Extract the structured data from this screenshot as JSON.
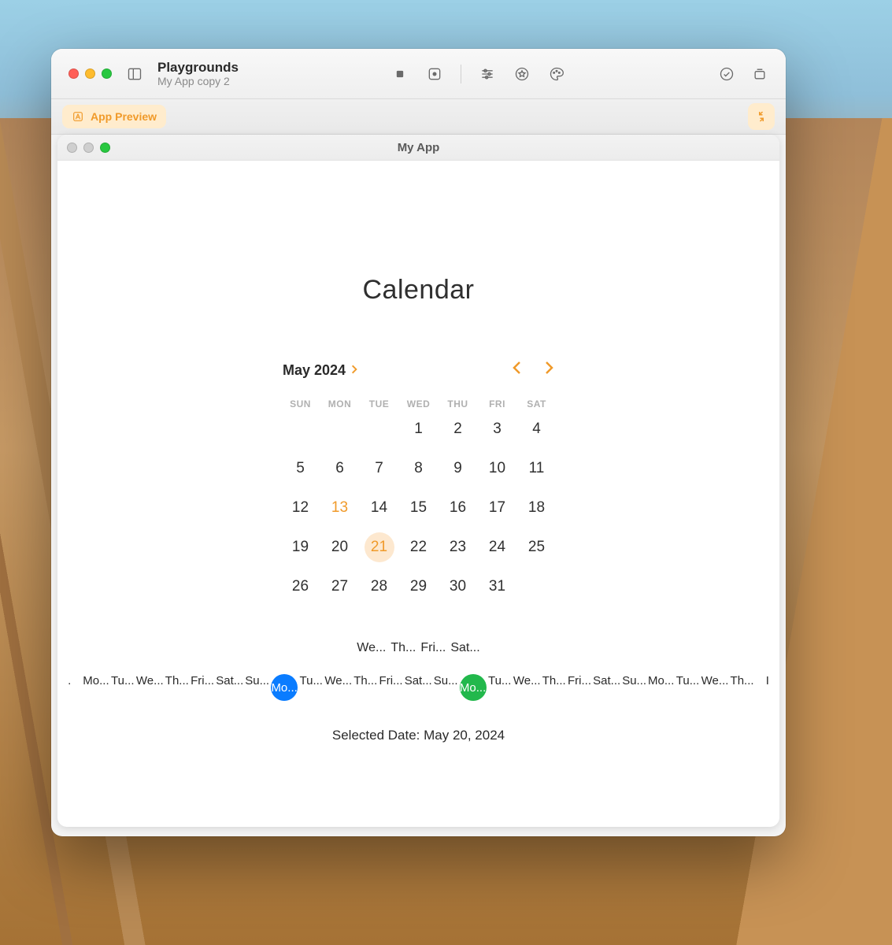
{
  "window": {
    "app_title": "Playgrounds",
    "doc_title": "My App copy 2"
  },
  "subbar": {
    "badge": "App Preview"
  },
  "inner": {
    "title": "My App"
  },
  "calendar": {
    "heading": "Calendar",
    "month": "May 2024",
    "dow": [
      "SUN",
      "MON",
      "TUE",
      "WED",
      "THU",
      "FRI",
      "SAT"
    ],
    "first_day_index": 3,
    "days_in_month": 31,
    "today": 13,
    "selected": 21
  },
  "strip_top": [
    "We...",
    "Th...",
    "Fri...",
    "Sat..."
  ],
  "strip_main": [
    {
      "t": "."
    },
    {
      "t": "Mo..."
    },
    {
      "t": "Tu..."
    },
    {
      "t": "We..."
    },
    {
      "t": "Th..."
    },
    {
      "t": "Fri..."
    },
    {
      "t": "Sat..."
    },
    {
      "t": "Su..."
    },
    {
      "t": "Mo...",
      "c": "blue"
    },
    {
      "t": "Tu..."
    },
    {
      "t": "We..."
    },
    {
      "t": "Th..."
    },
    {
      "t": "Fri..."
    },
    {
      "t": "Sat..."
    },
    {
      "t": "Su..."
    },
    {
      "t": "Mo...",
      "c": "green"
    },
    {
      "t": "Tu..."
    },
    {
      "t": "We..."
    },
    {
      "t": "Th..."
    },
    {
      "t": "Fri..."
    },
    {
      "t": "Sat..."
    },
    {
      "t": "Su..."
    },
    {
      "t": "Mo..."
    },
    {
      "t": "Tu..."
    },
    {
      "t": "We..."
    },
    {
      "t": "Th..."
    },
    {
      "t": "I"
    }
  ],
  "status": {
    "selected_date": "Selected Date: May 20, 2024"
  }
}
